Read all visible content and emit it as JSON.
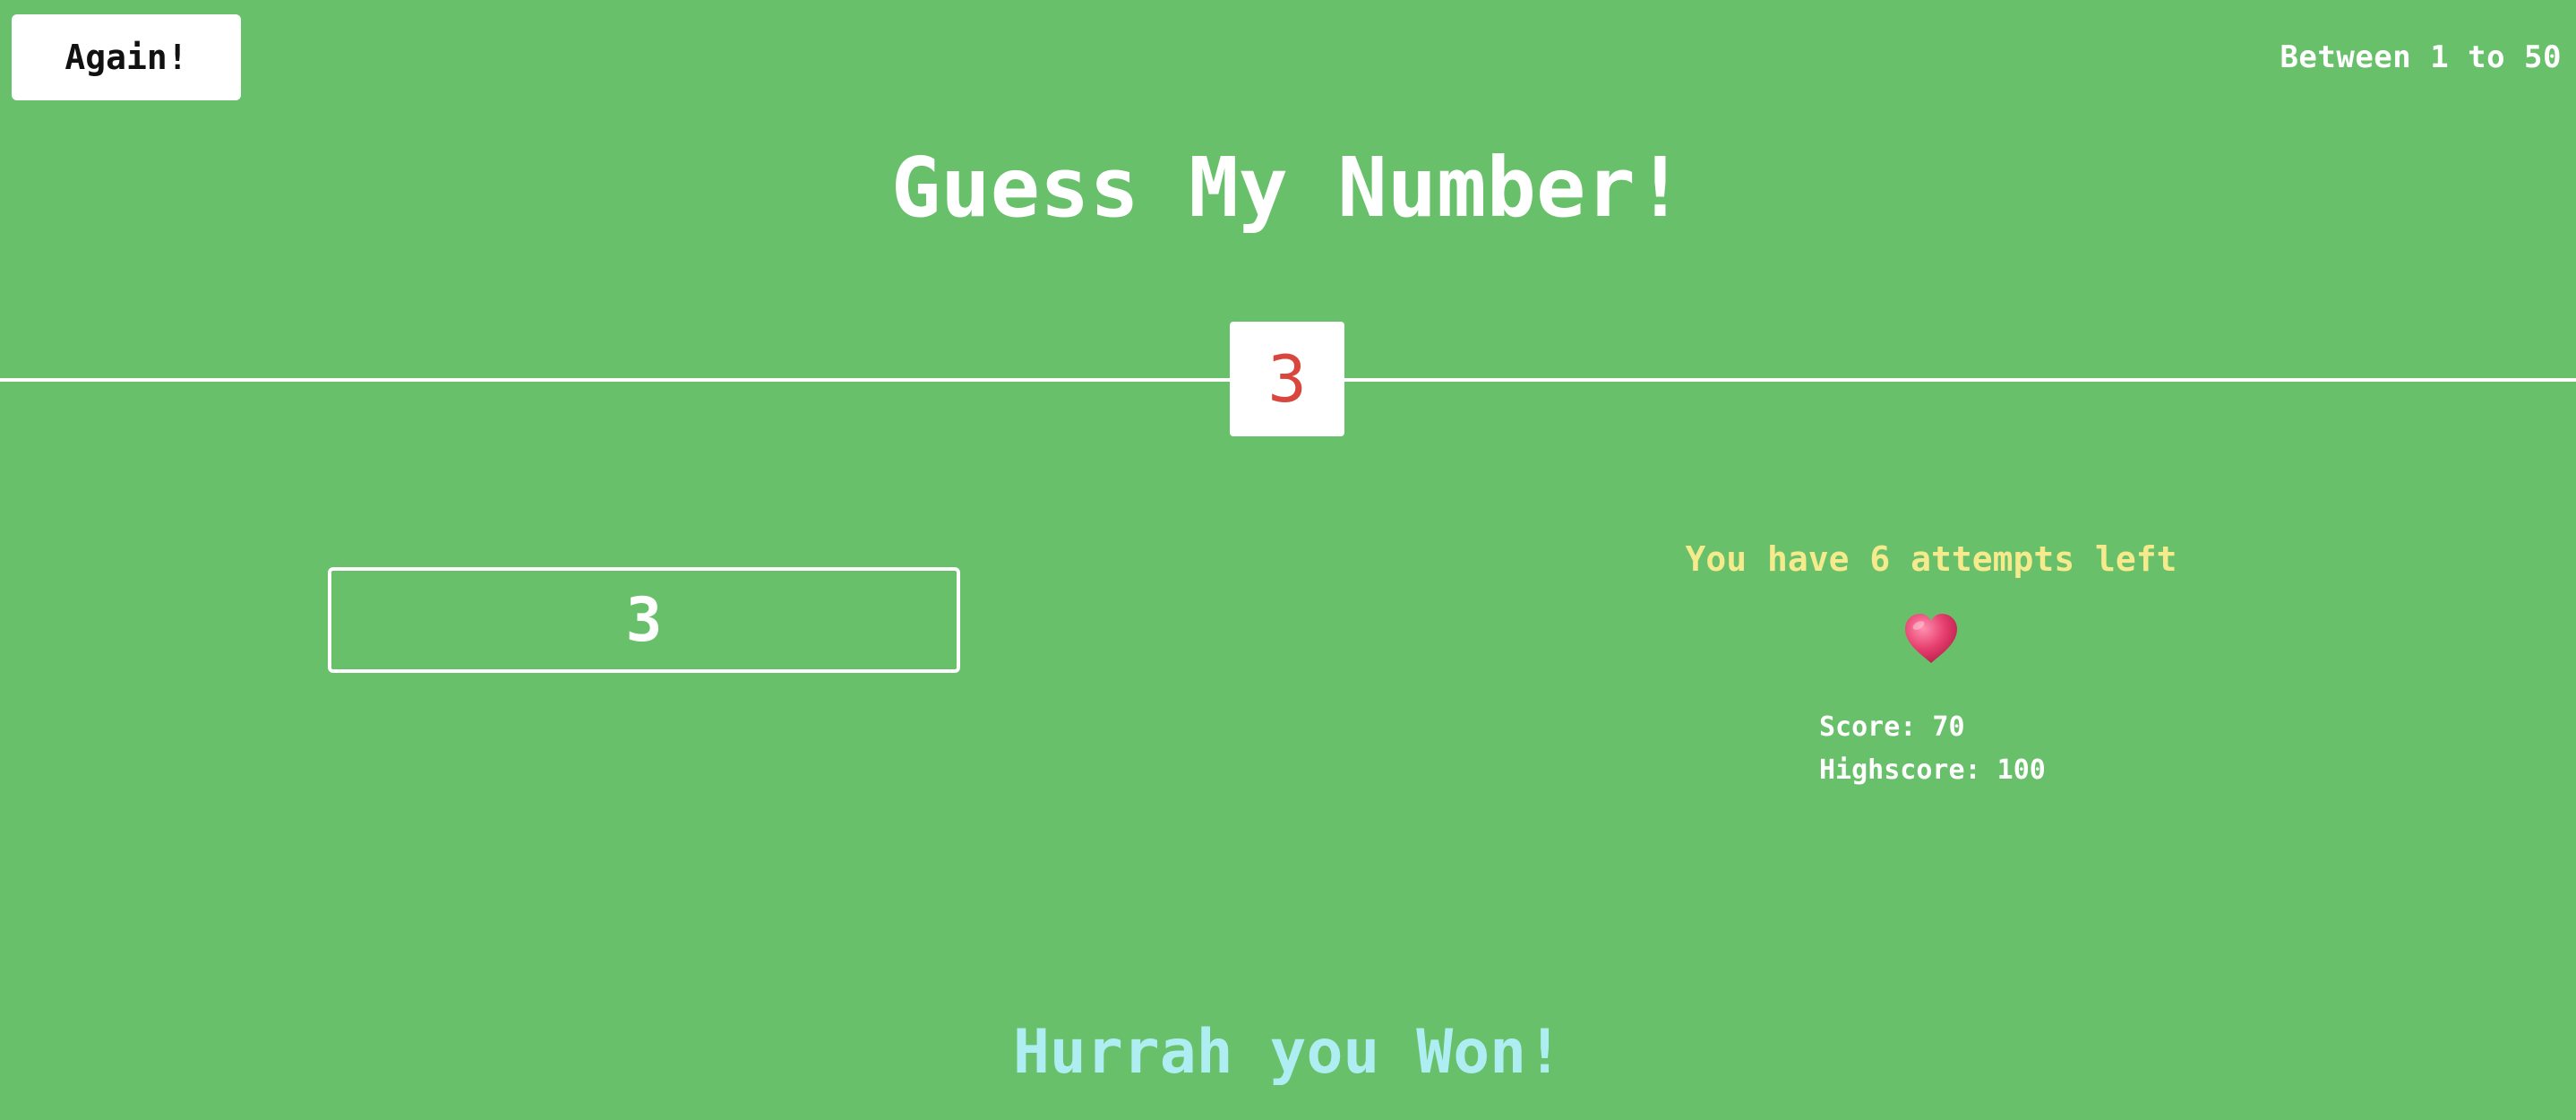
{
  "header": {
    "again_label": "Again!",
    "range_text": "Between 1 to 50"
  },
  "title": "Guess My Number!",
  "secret_number": "3",
  "guess": {
    "value": "3"
  },
  "status": {
    "attempts_text": "You have 6 attempts left",
    "heart_icon": "heart-icon",
    "score_text": "Score: 70",
    "highscore_text": "Highscore: 100"
  },
  "message": "Hurrah you Won!",
  "colors": {
    "background": "#68c06a",
    "number": "#d9463e",
    "attempts": "#f5ea8c",
    "message": "#aeeef3",
    "heart": "#e63f6e"
  }
}
